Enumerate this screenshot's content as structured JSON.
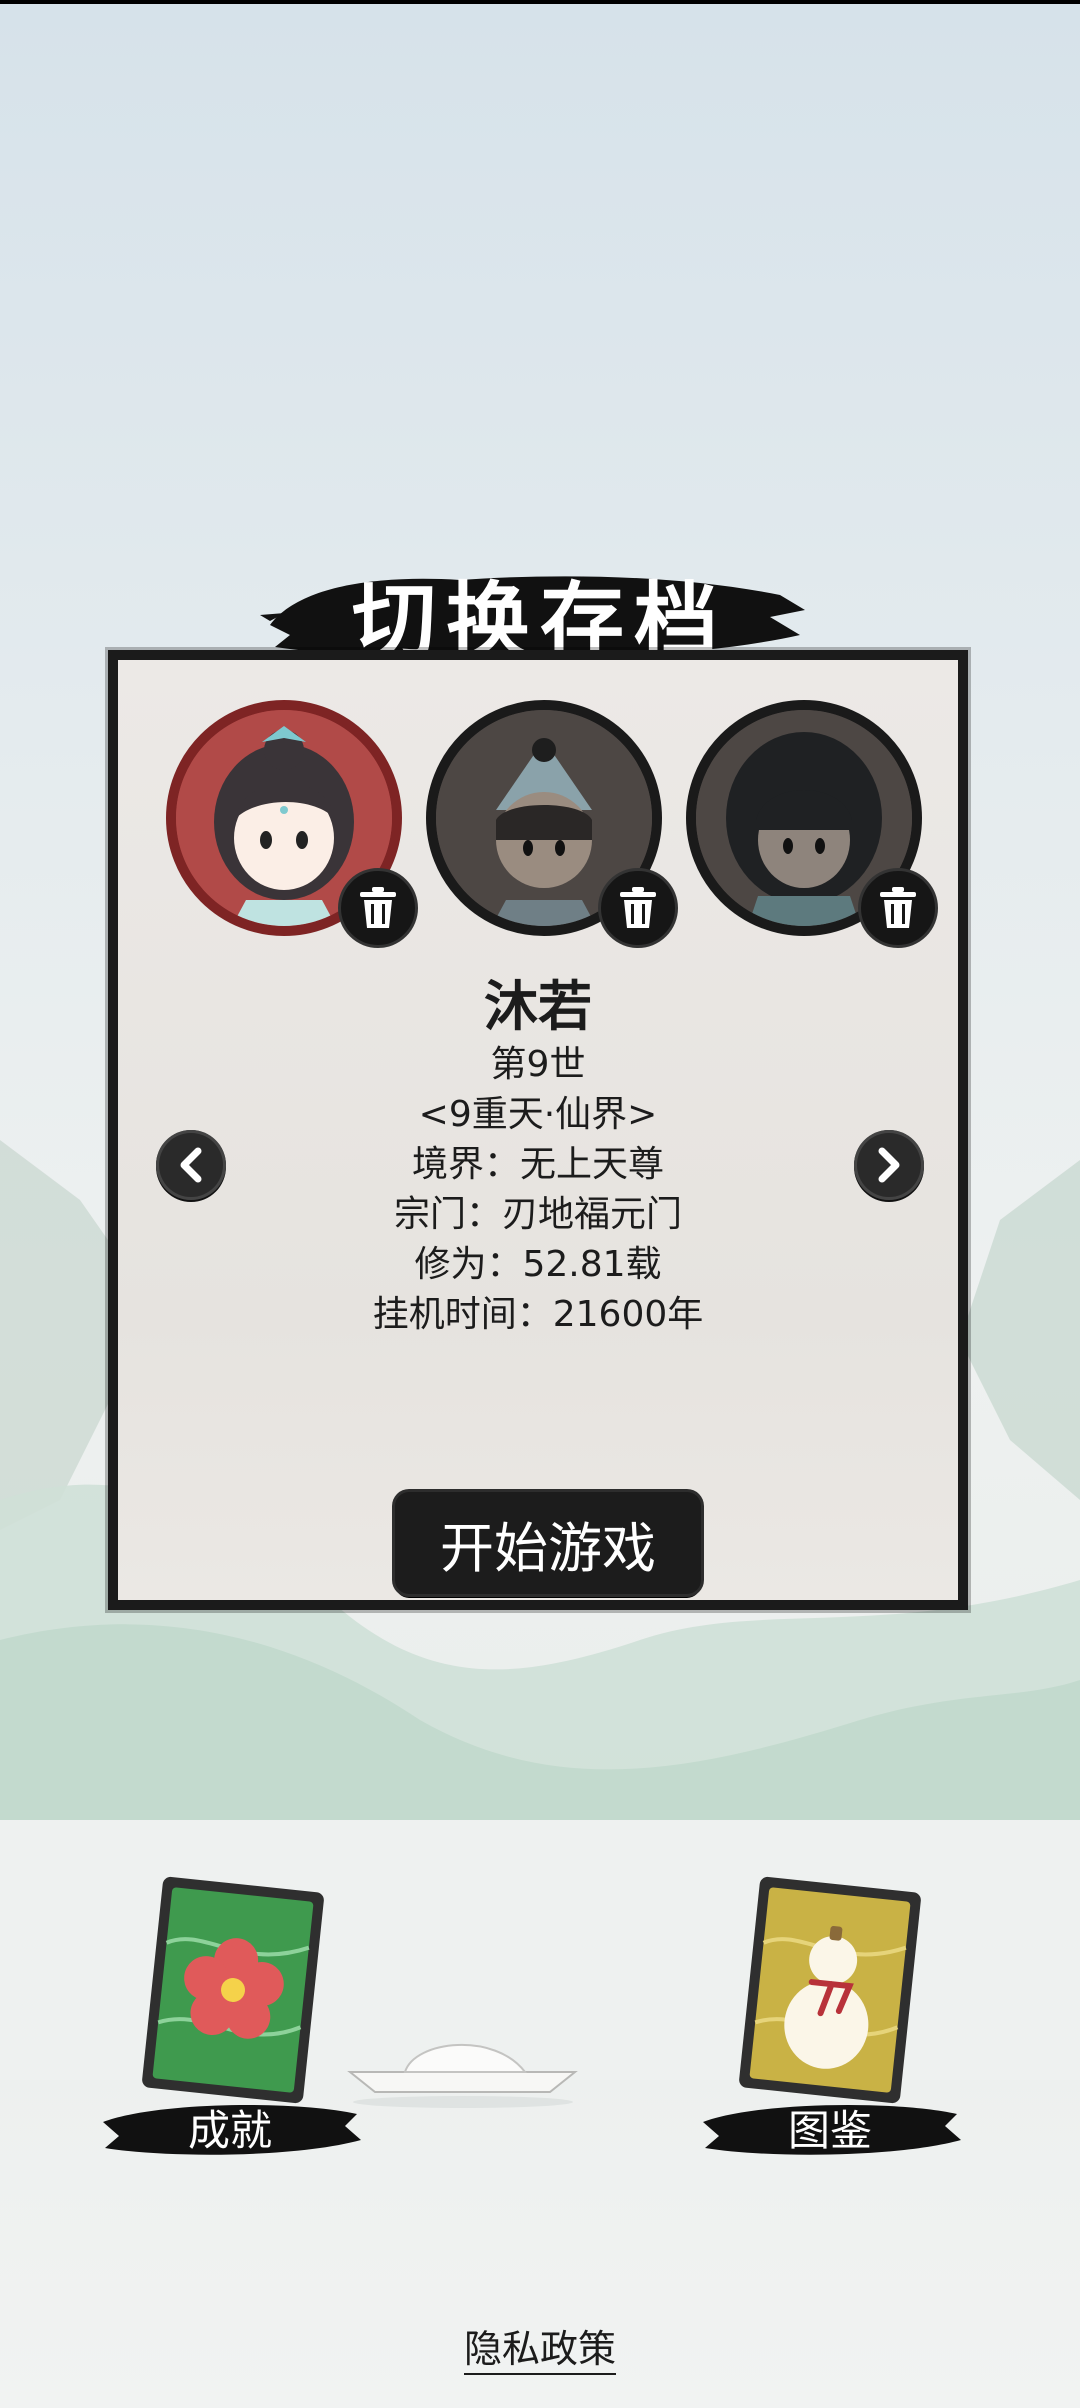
{
  "title": "切换存档",
  "character": {
    "name": "沐若",
    "generation": "第9世",
    "realm_world": "<9重天·仙界>",
    "cultivation_level": "境界：无上天尊",
    "sect": "宗门：刃地福元门",
    "cultivation": "修为：52.81载",
    "idle_time": "挂机时间：21600年"
  },
  "save_slots": [
    {
      "avatar": "female-cultivator-avatar",
      "selected": true
    },
    {
      "avatar": "male-cultivator-avatar",
      "selected": false
    },
    {
      "avatar": "female-dark-hair-avatar",
      "selected": false
    }
  ],
  "start_button": "开始游戏",
  "bottom": {
    "achievements_label": "成就",
    "atlas_label": "图鉴"
  },
  "privacy_label": "隐私政策",
  "colors": {
    "panel": "#e8e5e1",
    "ink": "#1c1c1c",
    "selected_ring": "#7e2424",
    "achievement_card": "#3f9a4e",
    "atlas_card": "#c9b245"
  }
}
